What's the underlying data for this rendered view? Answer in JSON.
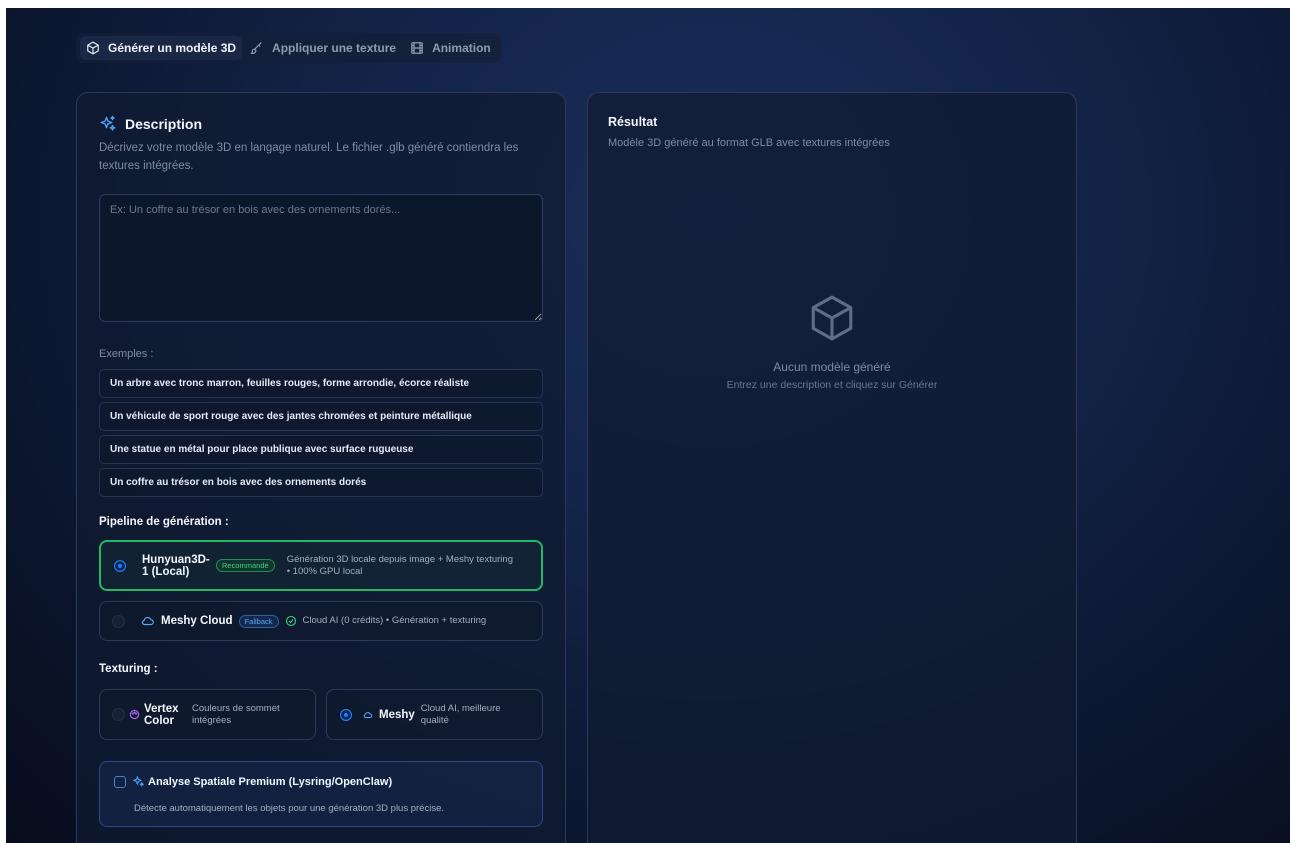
{
  "tabs": [
    {
      "label": "Générer un modèle 3D",
      "icon": "cube-icon",
      "active": true
    },
    {
      "label": "Appliquer une texture",
      "icon": "brush-icon",
      "active": false
    },
    {
      "label": "Animation",
      "icon": "film-icon",
      "active": false
    }
  ],
  "description": {
    "title": "Description",
    "subtitle": "Décrivez votre modèle 3D en langage naturel. Le fichier .glb généré contiendra les textures intégrées.",
    "placeholder": "Ex: Un coffre au trésor en bois avec des ornements dorés...",
    "value": ""
  },
  "examples": {
    "label": "Exemples :",
    "items": [
      "Un arbre avec tronc marron, feuilles rouges, forme arrondie, écorce réaliste",
      "Un véhicule de sport rouge avec des jantes chromées et peinture métallique",
      "Une statue en métal pour place publique avec surface rugueuse",
      "Un coffre au trésor en bois avec des ornements dorés"
    ]
  },
  "pipeline": {
    "label": "Pipeline de génération :",
    "options": [
      {
        "name": "Hunyuan3D-1 (Local)",
        "badge": "Recommandé",
        "desc": "Génération 3D locale depuis image + Meshy texturing • 100% GPU local",
        "selected": true
      },
      {
        "name": "Meshy Cloud",
        "badge": "Fallback",
        "desc": "Cloud AI (0 crédits) • Génération + texturing",
        "selected": false
      }
    ]
  },
  "texturing": {
    "label": "Texturing :",
    "options": [
      {
        "name": "Vertex Color",
        "desc": "Couleurs de sommet intégrées",
        "selected": false
      },
      {
        "name": "Meshy",
        "desc": "Cloud AI, meilleure qualité",
        "selected": true
      }
    ]
  },
  "premium": {
    "title": "Analyse Spatiale Premium (Lysring/OpenClaw)",
    "desc": "Détecte automatiquement les objets pour une génération 3D plus précise.",
    "checked": false
  },
  "result": {
    "title": "Résultat",
    "subtitle": "Modèle 3D généré au format GLB avec textures intégrées",
    "empty_title": "Aucun modèle généré",
    "empty_sub": "Entrez une description et cliquez sur Générer"
  },
  "colors": {
    "accent_blue": "#1f7fff",
    "accent_green": "#22b864",
    "background": "#0c1730"
  }
}
